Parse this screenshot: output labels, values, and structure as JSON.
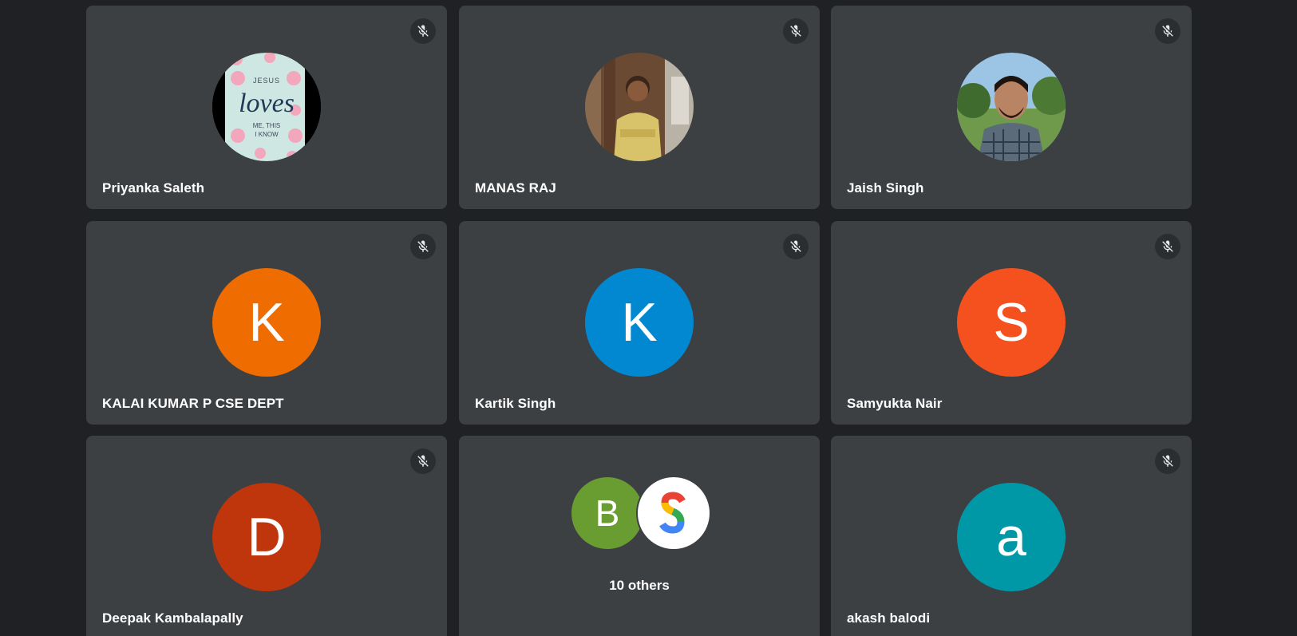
{
  "participants": [
    {
      "name": "Priyanka Saleth",
      "avatar": {
        "type": "photo",
        "description": "book cover",
        "text_line1": "JESUS",
        "text_script": "loves",
        "text_line2": "ME, THIS",
        "text_line3": "I KNOW"
      }
    },
    {
      "name": "MANAS RAJ",
      "avatar": {
        "type": "photo"
      }
    },
    {
      "name": "Jaish Singh",
      "avatar": {
        "type": "photo"
      }
    },
    {
      "name": "KALAI KUMAR P CSE DEPT",
      "avatar": {
        "type": "initial",
        "initial": "K",
        "color": "#ef6c00"
      }
    },
    {
      "name": "Kartik Singh",
      "avatar": {
        "type": "initial",
        "initial": "K",
        "color": "#0288d1"
      }
    },
    {
      "name": "Samyukta Nair",
      "avatar": {
        "type": "initial",
        "initial": "S",
        "color": "#f4511e"
      }
    },
    {
      "name": "Deepak Kambalapally",
      "avatar": {
        "type": "initial",
        "initial": "D",
        "color": "#bf360c"
      }
    },
    {
      "name": "akash balodi",
      "avatar": {
        "type": "initial",
        "initial": "a",
        "color": "#0097a7"
      }
    }
  ],
  "others": {
    "label": "10 others",
    "avatars": [
      {
        "initial": "B",
        "color": "#6a9d31"
      },
      {
        "icon": "google-s-logo"
      }
    ]
  },
  "icons": {
    "mute": "mic-off-icon"
  },
  "colors": {
    "background": "#202124",
    "tile": "#3c4043"
  }
}
